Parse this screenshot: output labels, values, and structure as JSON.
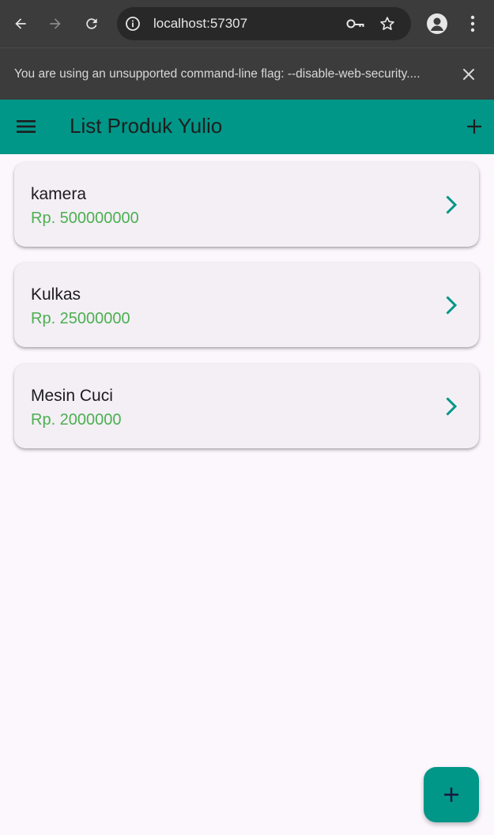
{
  "browser": {
    "url": "localhost:57307",
    "icons": [
      "back-arrow-icon",
      "forward-arrow-icon",
      "reload-icon",
      "site-info-icon",
      "password-key-icon",
      "bookmark-star-icon",
      "profile-icon",
      "kebab-menu-icon"
    ]
  },
  "infobar": {
    "message": "You are using an unsupported command-line flag: --disable-web-security....",
    "close_icon": "close-icon"
  },
  "appbar": {
    "title": "List Produk Yulio",
    "menu_icon": "hamburger-menu-icon",
    "add_icon": "plus-icon"
  },
  "products": [
    {
      "name": "kamera",
      "price": "Rp. 500000000"
    },
    {
      "name": "Kulkas",
      "price": "Rp. 25000000"
    },
    {
      "name": "Mesin Cuci",
      "price": "Rp. 2000000"
    }
  ],
  "fab": {
    "icon": "plus-icon"
  },
  "colors": {
    "primary": "#009688",
    "price_text": "#4caf50",
    "background": "#fcf6fd",
    "card": "#f3eff5",
    "browser_chrome": "#3c3c3c"
  }
}
